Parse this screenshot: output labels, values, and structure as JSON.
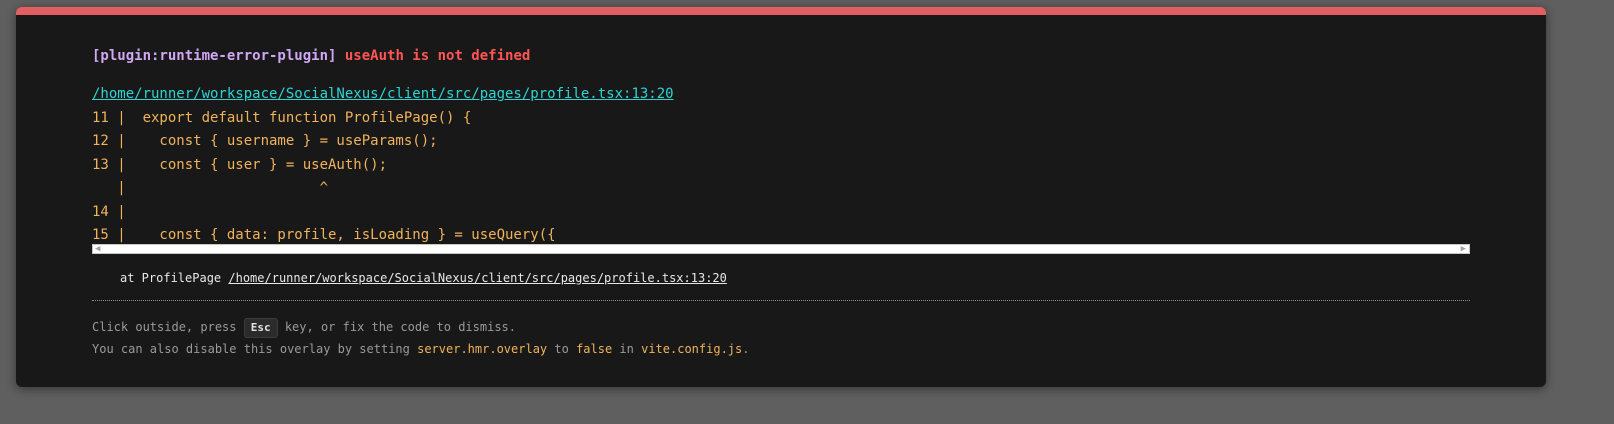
{
  "error": {
    "plugin": "[plugin:runtime-error-plugin]",
    "message": "useAuth is not defined",
    "file": "/home/runner/workspace/SocialNexus/client/src/pages/profile.tsx:13:20"
  },
  "frame": {
    "lines": [
      "11 |  export default function ProfilePage() {",
      "12 |    const { username } = useParams();",
      "13 |    const { user } = useAuth();",
      "   |                       ^",
      "14 |",
      "15 |    const { data: profile, isLoading } = useQuery({"
    ]
  },
  "stack": {
    "prefix": "at ProfilePage ",
    "link": "/home/runner/workspace/SocialNexus/client/src/pages/profile.tsx:13:20"
  },
  "tips": {
    "line1_pre": "Click outside, press ",
    "key": "Esc",
    "line1_post": " key, or fix the code to dismiss.",
    "line2_pre": "You can also disable this overlay by setting ",
    "setting": "server.hmr.overlay",
    "line2_mid1": " to ",
    "value": "false",
    "line2_mid2": " in ",
    "config": "vite.config.js",
    "line2_end": "."
  },
  "colors": {
    "accent": "#e35e60",
    "plugin": "#d0a7f5",
    "message": "#ff5555",
    "link": "#2dd4d4",
    "code": "#f0b35c",
    "background": "#181818"
  },
  "icons": {
    "scroll_left": "scroll-left-arrow-icon",
    "scroll_right": "scroll-right-arrow-icon"
  }
}
